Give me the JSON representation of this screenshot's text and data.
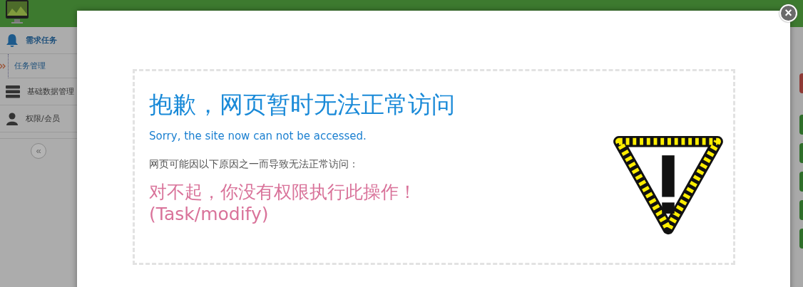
{
  "sidebar": {
    "items": [
      {
        "label": "需求任务",
        "selected": true,
        "children": [
          {
            "label": "任务管理",
            "selected": true
          }
        ]
      },
      {
        "label": "基础数据管理",
        "selected": false
      },
      {
        "label": "权限/会员",
        "selected": false
      }
    ],
    "collapse_button": "«"
  },
  "page_edge": {
    "buttons": [
      {
        "color": "#8e3a35"
      },
      {
        "color": "#2f6e2a"
      },
      {
        "color": "#2f6e2a"
      },
      {
        "color": "#2f6e2a"
      },
      {
        "color": "#2f6e2a"
      },
      {
        "color": "#2f6e2a"
      }
    ]
  },
  "dialog": {
    "close_button": "×",
    "title": "抱歉，网页暂时无法正常访问",
    "subtitle": "Sorry, the site now can not be accessed.",
    "reason_intro": "网页可能因以下原因之一而导致无法正常访问：",
    "message": "对不起，你没有权限执行此操作！",
    "detail": "(Task/modify)"
  }
}
